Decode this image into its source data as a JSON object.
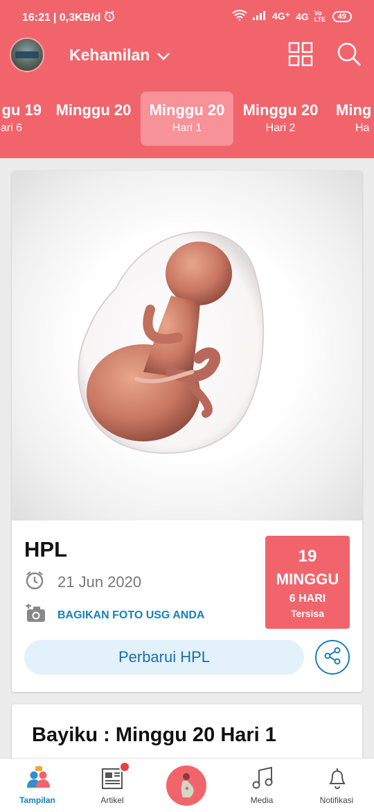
{
  "status_bar": {
    "time": "16:21",
    "speed": "| 0,3KB/d",
    "network1": "4G⁺",
    "network2": "4G",
    "volte": "Vo LTE",
    "battery": "49"
  },
  "app_bar": {
    "title": "Kehamilan"
  },
  "week_tabs": [
    {
      "week": "gu 19",
      "day": "ari 6"
    },
    {
      "week": "Minggu 20",
      "day": ""
    },
    {
      "week": "Minggu 20",
      "day": "Hari 1"
    },
    {
      "week": "Minggu 20",
      "day": "Hari 2"
    },
    {
      "week": "Ming",
      "day": "Ha"
    }
  ],
  "hpl_card": {
    "title": "HPL",
    "date": "21 Jun 2020",
    "share_usg": "BAGIKAN FOTO USG ANDA",
    "countdown": {
      "weeks_number": "19",
      "weeks_unit": "MINGGU",
      "days": "6 HARI",
      "remaining": "Tersisa"
    },
    "update_button": "Perbarui HPL"
  },
  "baby_card": {
    "title": "Bayiku : Minggu 20 Hari 1"
  },
  "bottom_nav": [
    {
      "label": "Tampilan",
      "icon": "people-icon"
    },
    {
      "label": "Artikel",
      "icon": "article-icon"
    },
    {
      "label": "",
      "icon": "pregnancy-icon"
    },
    {
      "label": "Media",
      "icon": "music-icon"
    },
    {
      "label": "Notifikasi",
      "icon": "bell-icon"
    }
  ],
  "colors": {
    "primary": "#f2646c",
    "link": "#1a7fb8",
    "button_bg": "#e3f1fb"
  }
}
